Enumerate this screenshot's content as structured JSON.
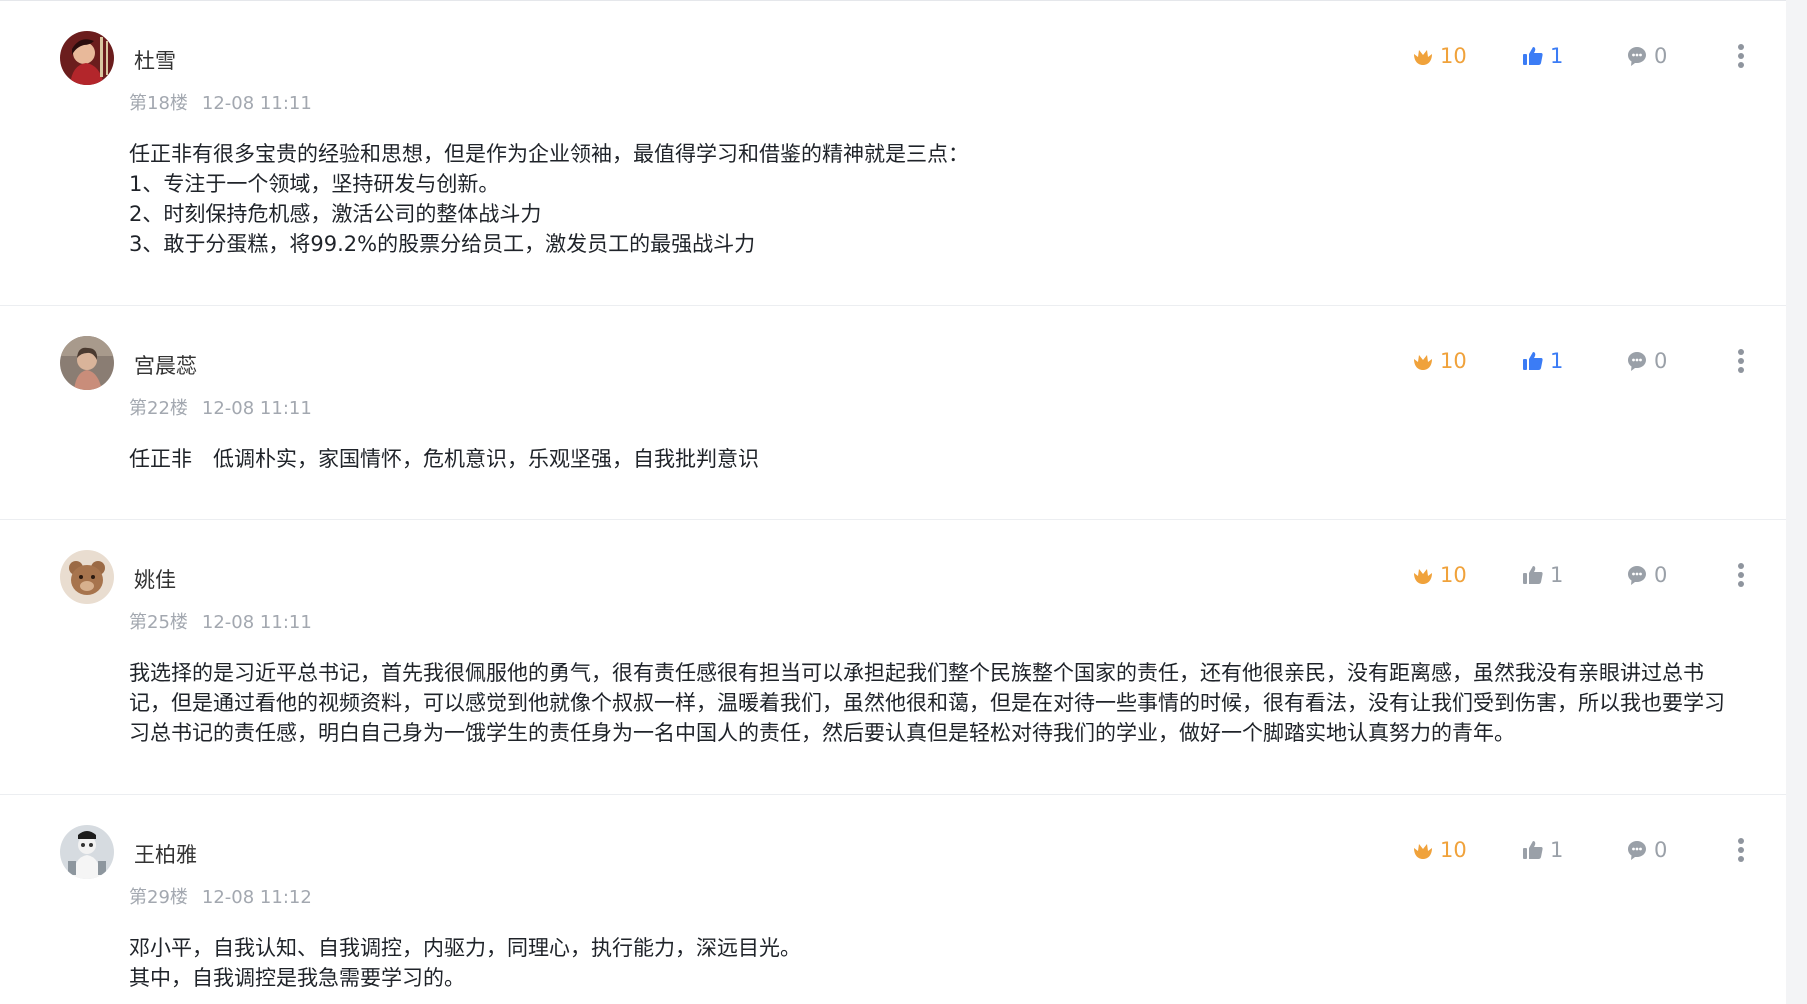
{
  "colors": {
    "flower": "#f0a23b",
    "like_active": "#3b7cf5",
    "like_inactive": "#9aa0a8",
    "reply": "#9aa0a8",
    "meta": "#a3a8b0",
    "text": "#1f2329"
  },
  "icons": {
    "flower": "flower-icon",
    "like": "thumbs-up-icon",
    "reply": "comment-bubble-icon",
    "more": "more-vertical-icon"
  },
  "comments": [
    {
      "username": "杜雪",
      "floor": "第18楼",
      "time": "12-08 11:11",
      "flowers": "10",
      "likes": "1",
      "liked": true,
      "replies": "0",
      "lines": [
        "任正非有很多宝贵的经验和思想，但是作为企业领袖，最值得学习和借鉴的精神就是三点：",
        "1、专注于一个领域，坚持研发与创新。",
        "2、时刻保持危机感，激活公司的整体战斗力",
        "3、敢于分蛋糕，将99.2%的股票分给员工，激发员工的最强战斗力"
      ]
    },
    {
      "username": "宫晨蕊",
      "floor": "第22楼",
      "time": "12-08 11:11",
      "flowers": "10",
      "likes": "1",
      "liked": true,
      "replies": "0",
      "lines": [
        "任正非　低调朴实，家国情怀，危机意识，乐观坚强，自我批判意识"
      ]
    },
    {
      "username": "姚佳",
      "floor": "第25楼",
      "time": "12-08 11:11",
      "flowers": "10",
      "likes": "1",
      "liked": false,
      "replies": "0",
      "lines": [
        "我选择的是习近平总书记，首先我很佩服他的勇气，很有责任感很有担当可以承担起我们整个民族整个国家的责任，还有他很亲民，没有距离感，虽然我没有亲眼讲过总书",
        "记，但是通过看他的视频资料，可以感觉到他就像个叔叔一样，温暖着我们，虽然他很和蔼，但是在对待一些事情的时候，很有看法，没有让我们受到伤害，所以我也要学习",
        "习总书记的责任感，明白自己身为一饿学生的责任身为一名中国人的责任，然后要认真但是轻松对待我们的学业，做好一个脚踏实地认真努力的青年。"
      ]
    },
    {
      "username": "王柏雅",
      "floor": "第29楼",
      "time": "12-08 11:12",
      "flowers": "10",
      "likes": "1",
      "liked": false,
      "replies": "0",
      "lines": [
        "邓小平，自我认知、自我调控，内驱力，同理心，执行能力，深远目光。",
        "其中，自我调控是我急需要学习的。"
      ]
    }
  ]
}
